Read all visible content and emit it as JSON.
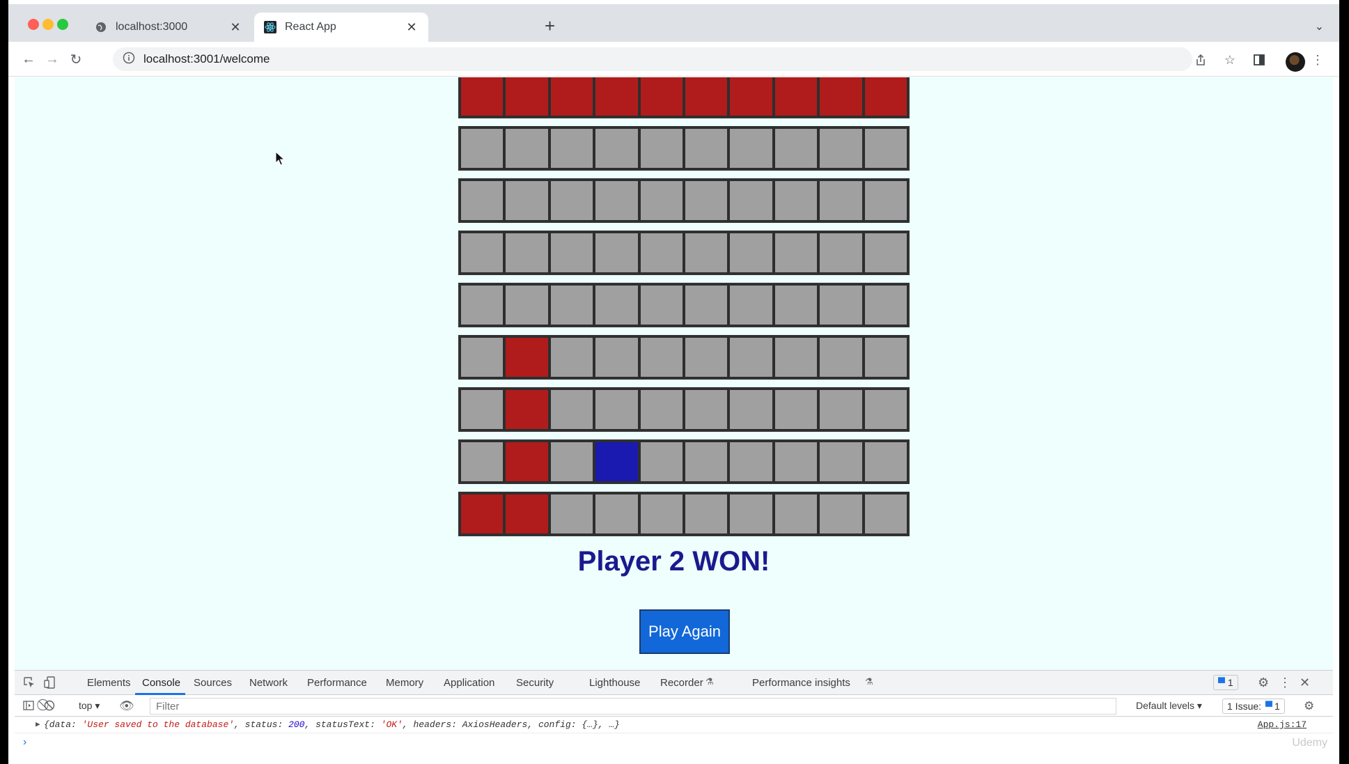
{
  "browser": {
    "tabs": [
      {
        "title": "localhost:3000",
        "active": false,
        "icon": "globe-icon"
      },
      {
        "title": "React App",
        "active": true,
        "icon": "react-icon"
      }
    ],
    "url": "localhost:3001/welcome"
  },
  "game": {
    "board": [
      [
        "red",
        "red",
        "red",
        "red",
        "red",
        "red",
        "red",
        "red",
        "red",
        "red"
      ],
      [
        "empty",
        "empty",
        "empty",
        "empty",
        "empty",
        "empty",
        "empty",
        "empty",
        "empty",
        "empty"
      ],
      [
        "empty",
        "empty",
        "empty",
        "empty",
        "empty",
        "empty",
        "empty",
        "empty",
        "empty",
        "empty"
      ],
      [
        "empty",
        "empty",
        "empty",
        "empty",
        "empty",
        "empty",
        "empty",
        "empty",
        "empty",
        "empty"
      ],
      [
        "empty",
        "empty",
        "empty",
        "empty",
        "empty",
        "empty",
        "empty",
        "empty",
        "empty",
        "empty"
      ],
      [
        "empty",
        "red",
        "empty",
        "empty",
        "empty",
        "empty",
        "empty",
        "empty",
        "empty",
        "empty"
      ],
      [
        "empty",
        "red",
        "empty",
        "empty",
        "empty",
        "empty",
        "empty",
        "empty",
        "empty",
        "empty"
      ],
      [
        "empty",
        "red",
        "empty",
        "blue",
        "empty",
        "empty",
        "empty",
        "empty",
        "empty",
        "empty"
      ],
      [
        "red",
        "red",
        "empty",
        "empty",
        "empty",
        "empty",
        "empty",
        "empty",
        "empty",
        "empty"
      ]
    ],
    "colors": {
      "red": "#b01c1c",
      "blue": "#1a1ab0",
      "empty": "#a0a0a0"
    },
    "winner_message": "Player 2 WON!",
    "play_again_label": "Play Again"
  },
  "devtools": {
    "tabs": [
      "Elements",
      "Console",
      "Sources",
      "Network",
      "Performance",
      "Memory",
      "Application",
      "Security",
      "Lighthouse",
      "Recorder",
      "Performance insights"
    ],
    "active_tab": "Console",
    "messages_badge": "1",
    "context": "top",
    "filter_placeholder": "Filter",
    "default_levels": "Default levels",
    "issues_label": "1 Issue:",
    "issues_count": "1",
    "log": {
      "prefix": "{data: ",
      "data_value": "'User saved to the database'",
      "status_key": ", status: ",
      "status_value": "200",
      "statustext_key": ", statusText: ",
      "statustext_value": "'OK'",
      "rest": ", headers: AxiosHeaders, config: {…}, …}",
      "source": "App.js:17"
    },
    "prompt": "›",
    "watermark": "Udemy"
  }
}
